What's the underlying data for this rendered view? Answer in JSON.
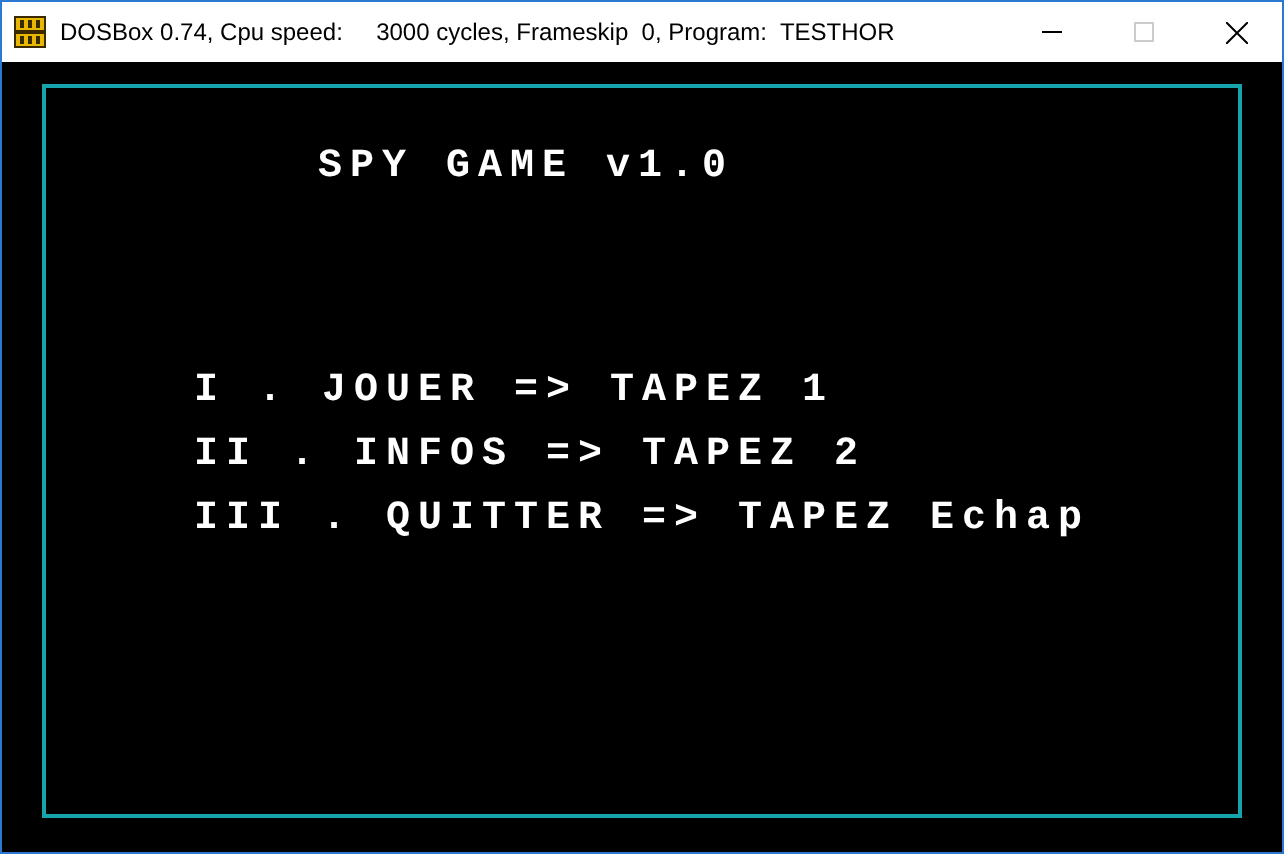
{
  "window": {
    "title": "DOSBox 0.74, Cpu speed:     3000 cycles, Frameskip  0, Program:  TESTHOR"
  },
  "window_controls": [
    {
      "kind": "minimize",
      "disabled": false
    },
    {
      "kind": "maximize",
      "disabled": true
    },
    {
      "kind": "close",
      "disabled": false
    }
  ],
  "screen": {
    "title": "SPY GAME v1.0",
    "menu": [
      "I . JOUER => TAPEZ 1",
      "II . INFOS => TAPEZ 2",
      "III . QUITTER => TAPEZ Echap"
    ]
  }
}
